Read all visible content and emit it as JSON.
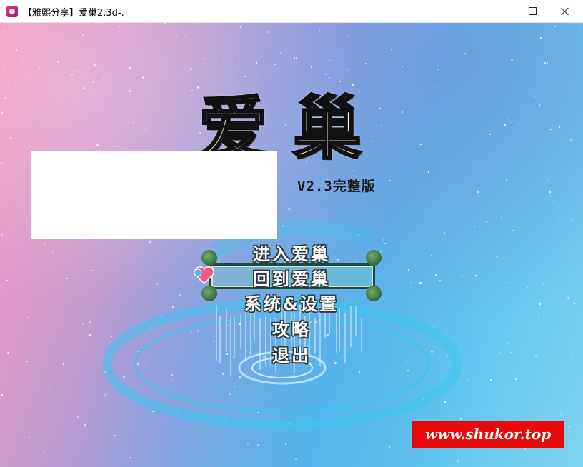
{
  "window": {
    "title": "【雅熙分享】爱巢2.3d-."
  },
  "game": {
    "logo_chars": [
      "爱",
      "巢"
    ],
    "version": "V2.3完整版",
    "menu": {
      "items": [
        "进入爱巢",
        "回到爱巢",
        "系统&设置",
        "攻略",
        "退出"
      ],
      "selected_index": 1
    }
  },
  "watermark": "www.shukor.top"
}
